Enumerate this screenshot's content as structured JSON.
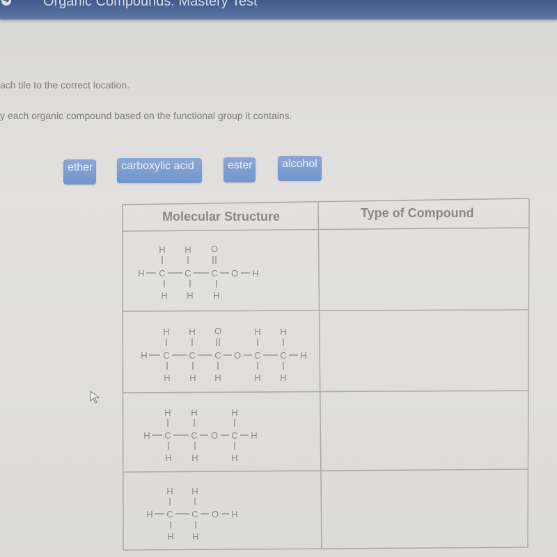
{
  "header": {
    "title": "Organic Compounds: Mastery Test",
    "nav_icon": "arrow-right-circle-icon"
  },
  "instructions": {
    "line1": "ach tile to the correct location.",
    "line2": "y each organic compound based on the functional group it contains."
  },
  "tiles": [
    {
      "label": "ether"
    },
    {
      "label": "carboxylic acid"
    },
    {
      "label": "ester"
    },
    {
      "label": "alcohol"
    }
  ],
  "table": {
    "headers": [
      "Molecular Structure",
      "Type of Compound"
    ],
    "rows": [
      {
        "structure": "CH3-CH2-COOH (propanoic acid)",
        "type": ""
      },
      {
        "structure": "CH3-CH2-COO-CH2-CH3 (ethyl propanoate)",
        "type": ""
      },
      {
        "structure": "CH3-CH2-O-CH3 (methoxyethane)",
        "type": ""
      },
      {
        "structure": "CH3-CH2-OH (ethanol)",
        "type": ""
      }
    ]
  },
  "atoms": {
    "H": "H",
    "C": "C",
    "O": "O"
  },
  "colors": {
    "header_bar": "#4d6898",
    "tile": "#7f9fd2",
    "tile_text": "#eef2f9",
    "text": "#7e7d7c",
    "grid": "#a9a8a6"
  }
}
